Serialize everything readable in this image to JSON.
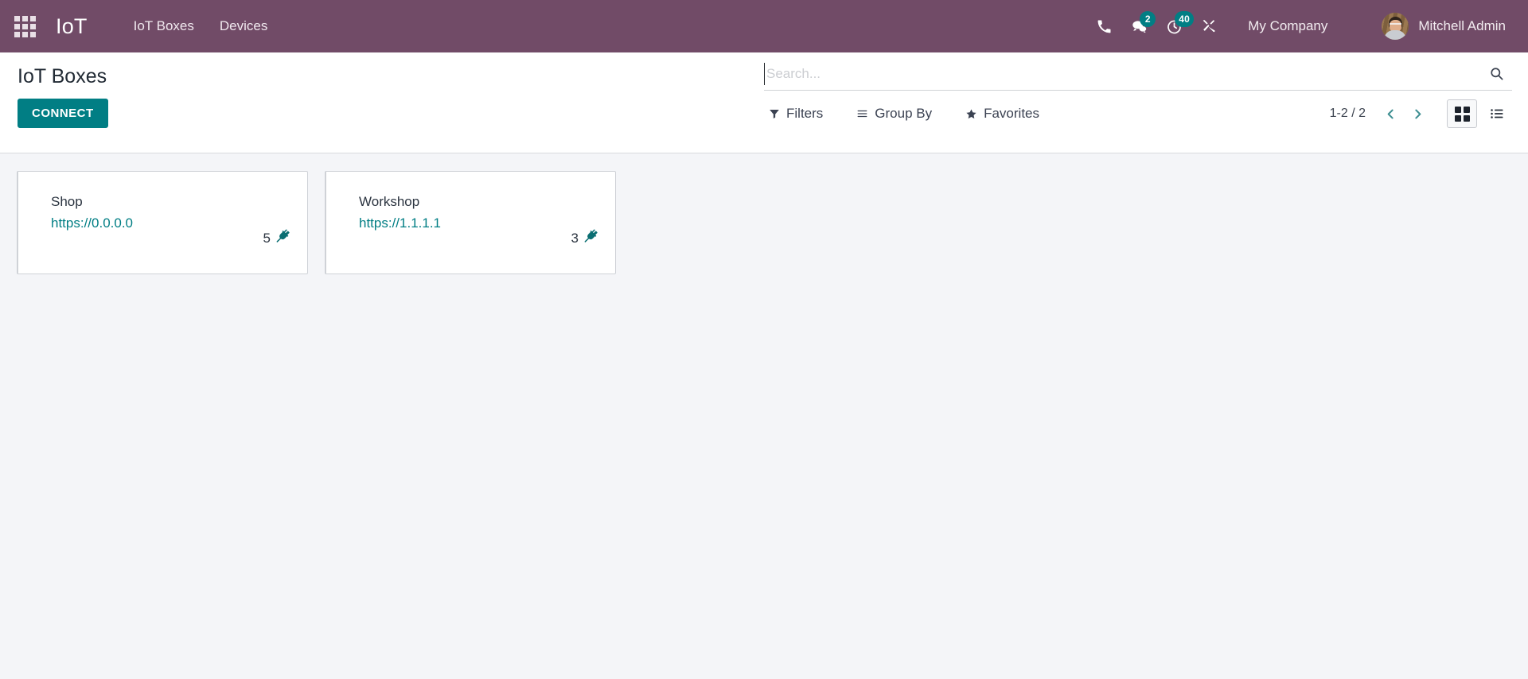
{
  "navbar": {
    "apps_icon": "apps-grid-icon",
    "brand": "IoT",
    "menu": [
      {
        "label": "IoT Boxes"
      },
      {
        "label": "Devices"
      }
    ],
    "systray": [
      {
        "name": "phone-icon",
        "icon": "phone-icon",
        "badge": ""
      },
      {
        "name": "messaging-icon",
        "icon": "chat-bubbles-icon",
        "badge": "2"
      },
      {
        "name": "activities-icon",
        "icon": "clock-icon",
        "badge": "40"
      },
      {
        "name": "debug-icon",
        "icon": "tools-icon",
        "badge": ""
      }
    ],
    "company": "My Company",
    "user": "Mitchell Admin",
    "colors": {
      "navbar_bg": "#714B67",
      "badge_bg": "#017e84",
      "nav_text": "#f0e8ee"
    }
  },
  "control_panel": {
    "title": "IoT Boxes",
    "connect_label": "CONNECT",
    "search": {
      "placeholder": "Search...",
      "value": "",
      "search_icon": "magnifier-icon"
    },
    "tools": [
      {
        "label": "Filters",
        "icon": "funnel-icon"
      },
      {
        "label": "Group By",
        "icon": "list-lines-icon"
      },
      {
        "label": "Favorites",
        "icon": "star-icon"
      }
    ],
    "pager": {
      "count": "1-2 / 2",
      "previous_icon": "chevron-left-icon",
      "next_icon": "chevron-right-icon"
    },
    "views": [
      {
        "name": "kanban",
        "icon": "kanban-icon",
        "active": true
      },
      {
        "name": "list",
        "icon": "list-view-icon",
        "active": false
      }
    ]
  },
  "kanban": {
    "cards": [
      {
        "name": "Shop",
        "url": "https://0.0.0.0",
        "device_count": "5",
        "device_icon": "plug-icon"
      },
      {
        "name": "Workshop",
        "url": "https://1.1.1.1",
        "device_count": "3",
        "device_icon": "plug-icon"
      }
    ]
  },
  "theme": {
    "primary": "#017e84",
    "brand_purple": "#714B67",
    "body_bg": "#f4f5f8",
    "link": "#017e84"
  }
}
